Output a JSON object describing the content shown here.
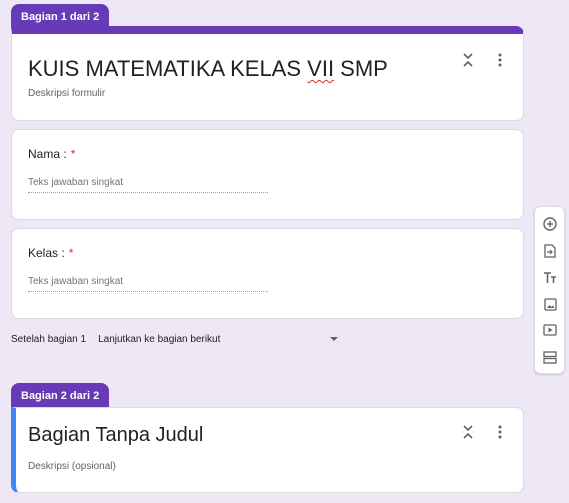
{
  "section1": {
    "tag": "Bagian 1 dari 2",
    "title_main": "KUIS MATEMATIKA KELAS ",
    "title_squiggle": "VII",
    "title_end": " SMP",
    "description": "Deskripsi formulir"
  },
  "questions": [
    {
      "label": "Nama :",
      "required": "*",
      "placeholder": "Teks jawaban singkat"
    },
    {
      "label": "Kelas :",
      "required": "*",
      "placeholder": "Teks jawaban singkat"
    }
  ],
  "after_section": {
    "label": "Setelah bagian 1",
    "value": "Lanjutkan ke bagian berikut"
  },
  "section2": {
    "tag": "Bagian 2 dari 2",
    "title": "Bagian Tanpa Judul",
    "description": "Deskripsi (opsional)"
  },
  "colors": {
    "accent": "#673ab7",
    "background": "#ede7f6",
    "required": "#d93025",
    "active_section": "#4285f4"
  },
  "toolbar_icons": [
    "add-question-icon",
    "import-questions-icon",
    "add-title-icon",
    "add-image-icon",
    "add-video-icon",
    "add-section-icon"
  ]
}
